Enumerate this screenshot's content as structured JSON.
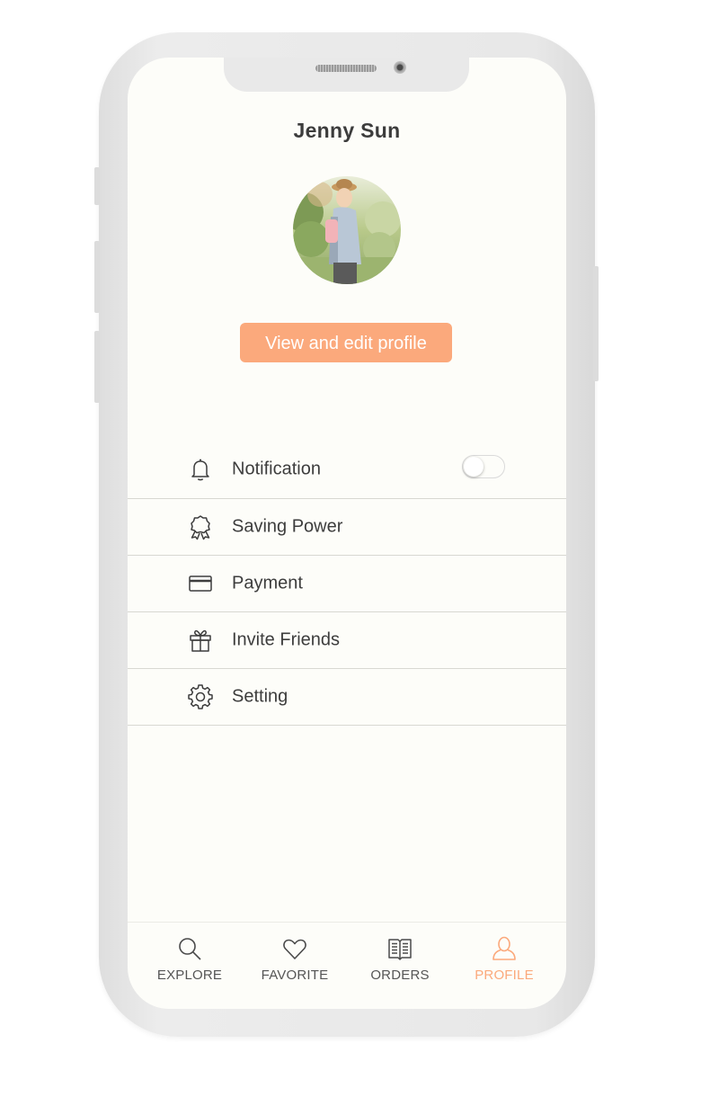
{
  "profile": {
    "name": "Jenny Sun",
    "edit_button_label": "View and edit profile"
  },
  "menu": {
    "items": [
      {
        "label": "Notification",
        "icon": "bell-icon",
        "toggle_on": false
      },
      {
        "label": "Saving Power",
        "icon": "award-ribbon-icon"
      },
      {
        "label": "Payment",
        "icon": "credit-card-icon"
      },
      {
        "label": "Invite Friends",
        "icon": "gift-icon"
      },
      {
        "label": "Setting",
        "icon": "gear-icon"
      }
    ]
  },
  "tabbar": {
    "tabs": [
      {
        "label": "EXPLORE",
        "icon": "search-icon"
      },
      {
        "label": "FAVORITE",
        "icon": "heart-icon"
      },
      {
        "label": "ORDERS",
        "icon": "book-icon"
      },
      {
        "label": "PROFILE",
        "icon": "person-icon",
        "active": true
      }
    ]
  },
  "colors": {
    "accent": "#fba97c",
    "screen_background": "#fdfdf9",
    "text": "#3d3d3d"
  }
}
